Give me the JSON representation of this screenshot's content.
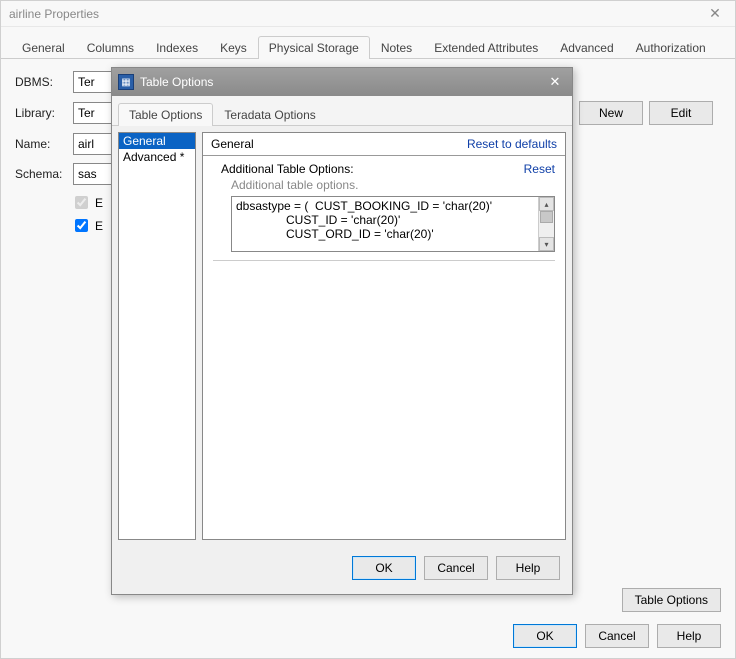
{
  "window": {
    "title": "airline Properties"
  },
  "tabs": {
    "general": "General",
    "columns": "Columns",
    "indexes": "Indexes",
    "keys": "Keys",
    "physical_storage": "Physical Storage",
    "notes": "Notes",
    "extended_attributes": "Extended Attributes",
    "advanced": "Advanced",
    "authorization": "Authorization"
  },
  "labels": {
    "dbms": "DBMS:",
    "library": "Library:",
    "name": "Name:",
    "schema": "Schema:"
  },
  "fields": {
    "dbms_value": "Ter",
    "library_value": "Ter",
    "name_value": "airl",
    "schema_value": "sas",
    "check1_partial": "E",
    "check2_partial": "E"
  },
  "buttons": {
    "new": "New",
    "edit": "Edit",
    "table_options": "Table Options",
    "ok": "OK",
    "cancel": "Cancel",
    "help": "Help"
  },
  "modal": {
    "title": "Table Options",
    "tabs": {
      "table_options": "Table Options",
      "teradata_options": "Teradata Options"
    },
    "list": {
      "general": "General",
      "advanced": "Advanced *"
    },
    "section": {
      "title": "General",
      "reset_defaults": "Reset to defaults"
    },
    "option": {
      "label": "Additional Table Options:",
      "reset": "Reset",
      "hint": "Additional table options."
    },
    "textarea": {
      "line1": "dbsastype = (  CUST_BOOKING_ID = 'char(20)'",
      "line2": "               CUST_ID = 'char(20)'",
      "line3": "               CUST_ORD_ID = 'char(20)'"
    },
    "buttons": {
      "ok": "OK",
      "cancel": "Cancel",
      "help": "Help"
    }
  }
}
